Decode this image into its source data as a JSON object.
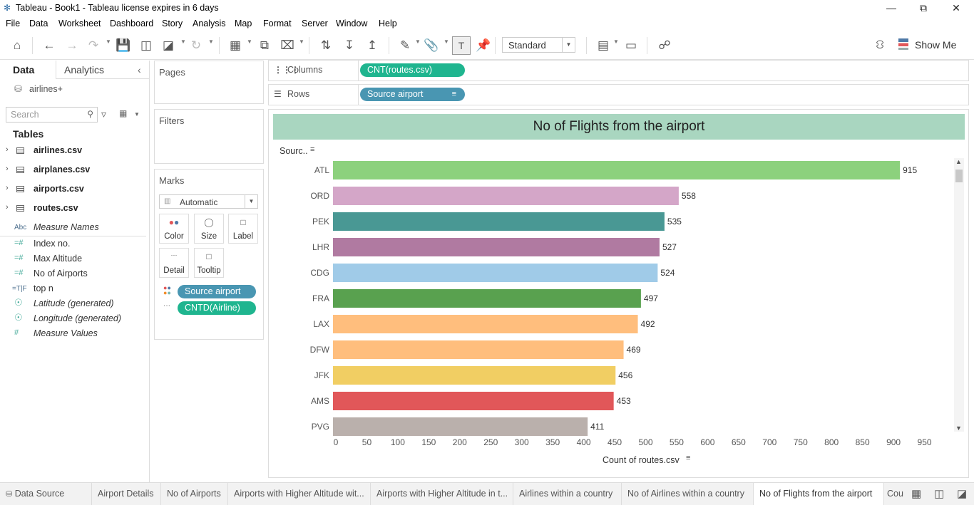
{
  "window": {
    "title": "Tableau - Book1 - Tableau license expires in 6 days"
  },
  "menu": [
    "File",
    "Data",
    "Worksheet",
    "Dashboard",
    "Story",
    "Analysis",
    "Map",
    "Format",
    "Server",
    "Window",
    "Help"
  ],
  "toolbar": {
    "fit_value": "Standard",
    "show_me_label": "Show Me"
  },
  "data_pane": {
    "tab_data": "Data",
    "tab_analytics": "Analytics",
    "datasource": "airlines+",
    "search_placeholder": "Search",
    "tables_header": "Tables",
    "tables": [
      "airlines.csv",
      "airplanes.csv",
      "airports.csv",
      "routes.csv"
    ],
    "fields": [
      {
        "icon": "Abc",
        "label": "Measure Names"
      },
      {
        "icon": "=#",
        "label": "Index no."
      },
      {
        "icon": "=#",
        "label": "Max Altitude"
      },
      {
        "icon": "=#",
        "label": "No of Airports"
      },
      {
        "icon": "=T|F",
        "label": "top n"
      },
      {
        "icon": "globe",
        "label": "Latitude (generated)"
      },
      {
        "icon": "globe",
        "label": "Longitude (generated)"
      },
      {
        "icon": "#",
        "label": "Measure Values"
      }
    ]
  },
  "cards": {
    "pages": "Pages",
    "filters": "Filters",
    "marks": "Marks",
    "mark_type": "Automatic",
    "buttons": [
      "Color",
      "Size",
      "Label",
      "Detail",
      "Tooltip"
    ],
    "pills": [
      "Source airport",
      "CNTD(Airline)"
    ]
  },
  "shelves": {
    "columns_label": "Columns",
    "columns_pill": "CNT(routes.csv)",
    "rows_label": "Rows",
    "rows_pill": "Source airport"
  },
  "colors": {
    "measure_pill": "#1fb58f",
    "dimension_pill": "#4996b2",
    "title_band": "#a9d6c0"
  },
  "chart_data": {
    "type": "bar",
    "orientation": "horizontal",
    "title": "No of Flights from the airport",
    "ylabel": "Sourc..",
    "xlabel": "Count of routes.csv",
    "categories": [
      "ATL",
      "ORD",
      "PEK",
      "LHR",
      "CDG",
      "FRA",
      "LAX",
      "DFW",
      "JFK",
      "AMS",
      "PVG"
    ],
    "values": [
      915,
      558,
      535,
      527,
      524,
      497,
      492,
      469,
      456,
      453,
      411
    ],
    "colors": [
      "#8cd17d",
      "#d4a6c8",
      "#499894",
      "#b07aa1",
      "#a0cbe8",
      "#59a14f",
      "#ffbe7d",
      "#ffbe7d",
      "#f1ce63",
      "#e15759",
      "#bab0ac"
    ],
    "xticks": [
      0,
      50,
      100,
      150,
      200,
      250,
      300,
      350,
      400,
      450,
      500,
      550,
      600,
      650,
      700,
      750,
      800,
      850,
      900,
      950
    ],
    "xlim": [
      0,
      990
    ],
    "grid": false
  },
  "sheet_tabs": {
    "data_source": "Data Source",
    "tabs": [
      "Airport Details",
      "No of Airports",
      "Airports with Higher Altitude wit...",
      "Airports with Higher Altitude in t...",
      "Airlines within a country",
      "No of Airlines within a country",
      "No of Flights from the airport",
      "Cou"
    ]
  }
}
